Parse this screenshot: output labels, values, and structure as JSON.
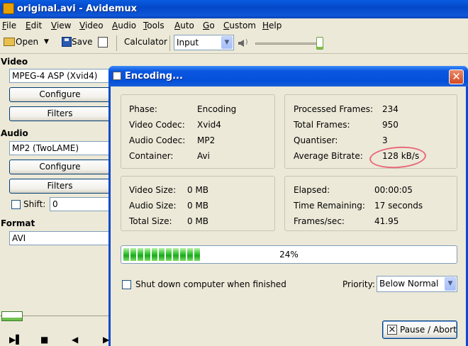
{
  "window": {
    "title": "original.avi - Avidemux"
  },
  "menu": [
    "File",
    "Edit",
    "View",
    "Video",
    "Audio",
    "Tools",
    "Auto",
    "Go",
    "Custom",
    "Help"
  ],
  "toolbar": {
    "open_label": "Open",
    "save_label": "Save",
    "calculator_label": "Calculator",
    "input_select": "Input",
    "volume_level": 0.9
  },
  "left": {
    "video_label": "Video",
    "video_codec": "MPEG-4 ASP (Xvid4)",
    "configure_label": "Configure",
    "filters_label": "Filters",
    "audio_label": "Audio",
    "audio_codec": "MP2 (TwoLAME)",
    "shift_label": "Shift:",
    "shift_value": "0",
    "format_label": "Format",
    "format_value": "AVI"
  },
  "dialog": {
    "title": "Encoding...",
    "close_glyph": "✕",
    "info": {
      "phase_label": "Phase:",
      "phase": "Encoding",
      "video_codec_label": "Video Codec:",
      "video_codec": "Xvid4",
      "audio_codec_label": "Audio Codec:",
      "audio_codec": "MP2",
      "container_label": "Container:",
      "container": "Avi"
    },
    "stats": {
      "processed_label": "Processed Frames:",
      "processed": "234",
      "total_label": "Total Frames:",
      "total": "950",
      "quantiser_label": "Quantiser:",
      "quantiser": "3",
      "bitrate_label": "Average Bitrate:",
      "bitrate": "128 kB/s"
    },
    "sizes": {
      "video_label": "Video Size:",
      "video": "0 MB",
      "audio_label": "Audio Size:",
      "audio": "0 MB",
      "total_label": "Total Size:",
      "total": "0 MB"
    },
    "time": {
      "elapsed_label": "Elapsed:",
      "elapsed": "00:00:05",
      "remaining_label": "Time Remaining:",
      "remaining": "17 seconds",
      "fps_label": "Frames/sec:",
      "fps": "41.95"
    },
    "progress": {
      "percent_text": "24%",
      "value": 0.24
    },
    "shutdown_label": "Shut down computer when finished",
    "priority_label": "Priority:",
    "priority_value": "Below Normal",
    "pause_label": "Pause / Abort",
    "colors": {
      "highlight": "#e86a7a",
      "progress": "#30c030"
    }
  }
}
